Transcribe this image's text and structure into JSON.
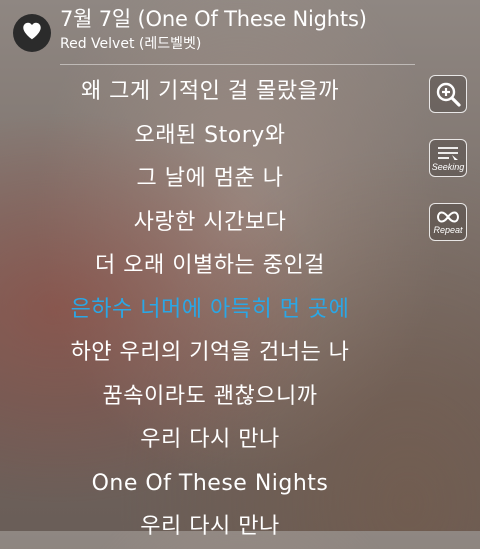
{
  "header": {
    "title": "7월 7일 (One Of These Nights)",
    "artist": "Red Velvet (레드벨벳)"
  },
  "lyrics": [
    "왜 그게 기적인 걸 몰랐을까",
    "오래된 Story와",
    "그 날에 멈춘 나",
    "사랑한 시간보다",
    "더 오래 이별하는 중인걸",
    "은하수 너머에 아득히 먼 곳에",
    "하얀 우리의 기억을 건너는 나",
    "꿈속이라도 괜찮으니까",
    "우리 다시 만나",
    "One Of These Nights",
    "우리 다시 만나"
  ],
  "active_line_index": 5,
  "colors": {
    "active_lyric": "#2aa7e6",
    "lyric": "#ffffff"
  },
  "side_controls": {
    "zoom_icon": "zoom-in-icon",
    "seeking_label": "Seeking",
    "repeat_label": "Repeat"
  }
}
